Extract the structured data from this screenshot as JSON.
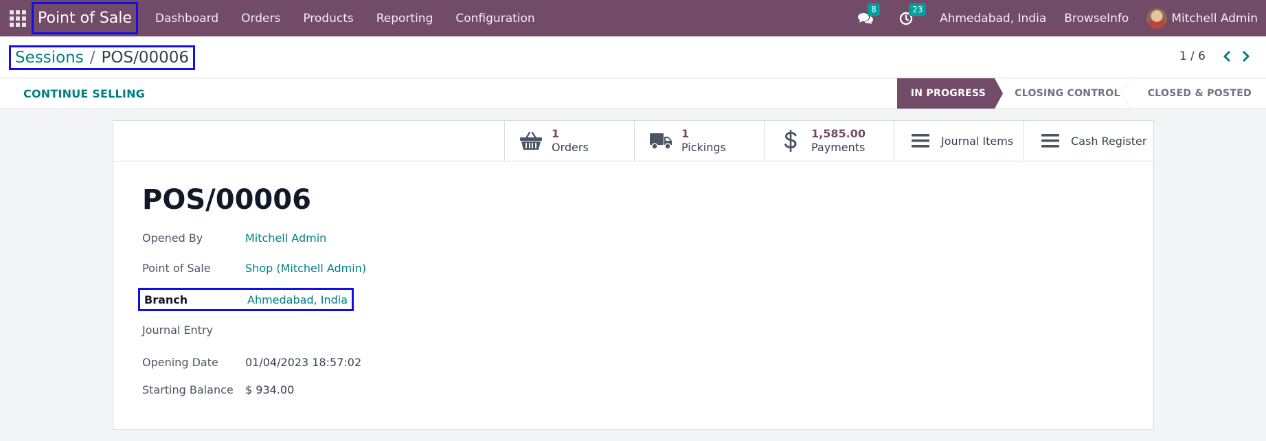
{
  "navbar": {
    "app_name": "Point of Sale",
    "menu": [
      "Dashboard",
      "Orders",
      "Products",
      "Reporting",
      "Configuration"
    ],
    "messages_count": "8",
    "activities_count": "23",
    "company_branch": "Ahmedabad, India",
    "company": "BrowseInfo",
    "user": "Mitchell Admin",
    "icons": [
      "apps-grid-icon",
      "chat-icon",
      "clock-icon",
      "avatar"
    ],
    "color": "#714b67"
  },
  "breadcrumb": {
    "parent": "Sessions",
    "separator": "/",
    "current": "POS/00006"
  },
  "pager": {
    "value": "1 / 6"
  },
  "statusbar": {
    "continue_label": "CONTINUE SELLING",
    "stages": [
      "IN PROGRESS",
      "CLOSING CONTROL",
      "CLOSED & POSTED"
    ],
    "active_stage": "IN PROGRESS"
  },
  "smart_buttons": {
    "orders": {
      "value": "1",
      "label": "Orders"
    },
    "pickings": {
      "value": "1",
      "label": "Pickings"
    },
    "payments": {
      "value": "1,585.00",
      "label": "Payments"
    },
    "journal_items": "Journal Items",
    "cash_register": "Cash Register"
  },
  "record": {
    "title": "POS/00006",
    "fields": {
      "opened_by": {
        "label": "Opened By",
        "value": "Mitchell Admin"
      },
      "point_of_sale": {
        "label": "Point of Sale",
        "value": "Shop (Mitchell Admin)"
      },
      "branch": {
        "label": "Branch",
        "value": "Ahmedabad, India"
      },
      "journal_entry": {
        "label": "Journal Entry",
        "value": ""
      },
      "opening_date": {
        "label": "Opening Date",
        "value": "01/04/2023 18:57:02"
      },
      "starting_balance": {
        "label": "Starting Balance",
        "value": "$ 934.00"
      }
    }
  },
  "colors": {
    "brand": "#714b67",
    "link": "#017e84",
    "highlight": "#1010e6"
  }
}
